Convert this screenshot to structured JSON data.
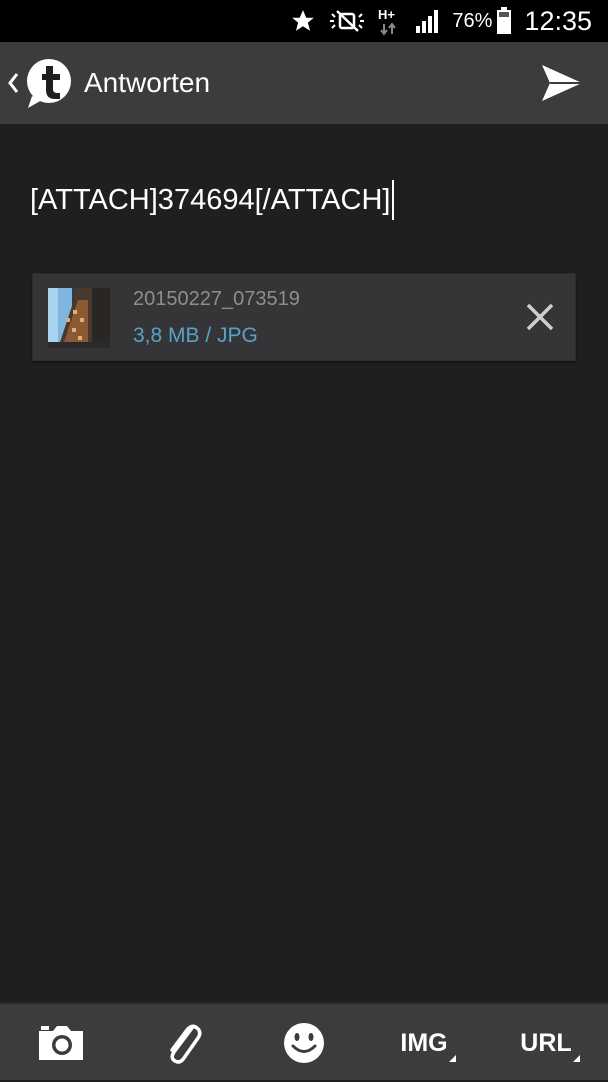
{
  "status_bar": {
    "battery_percent": "76%",
    "time": "12:35",
    "network": "H+",
    "icons": [
      "star-icon",
      "mute-icon",
      "network-type-icon",
      "signal-icon",
      "battery-icon"
    ]
  },
  "app_bar": {
    "title": "Antworten",
    "icons": [
      "back-chevron-icon",
      "tapatalk-logo-icon",
      "send-icon"
    ]
  },
  "editor": {
    "value": "[ATTACH]374694[/ATTACH]"
  },
  "attachment": {
    "file_name": "20150227_073519",
    "file_info": "3,8 MB / JPG",
    "icons": [
      "image-thumbnail",
      "close-icon"
    ]
  },
  "toolbar": {
    "img_label": "IMG",
    "url_label": "URL",
    "icons": [
      "camera-icon",
      "paperclip-icon",
      "smiley-icon"
    ]
  },
  "colors": {
    "background": "#1f1f21",
    "app_bar": "#3c3c3e",
    "accent_blue": "#5aa0c8",
    "file_name_gray": "#8e8e8e"
  }
}
